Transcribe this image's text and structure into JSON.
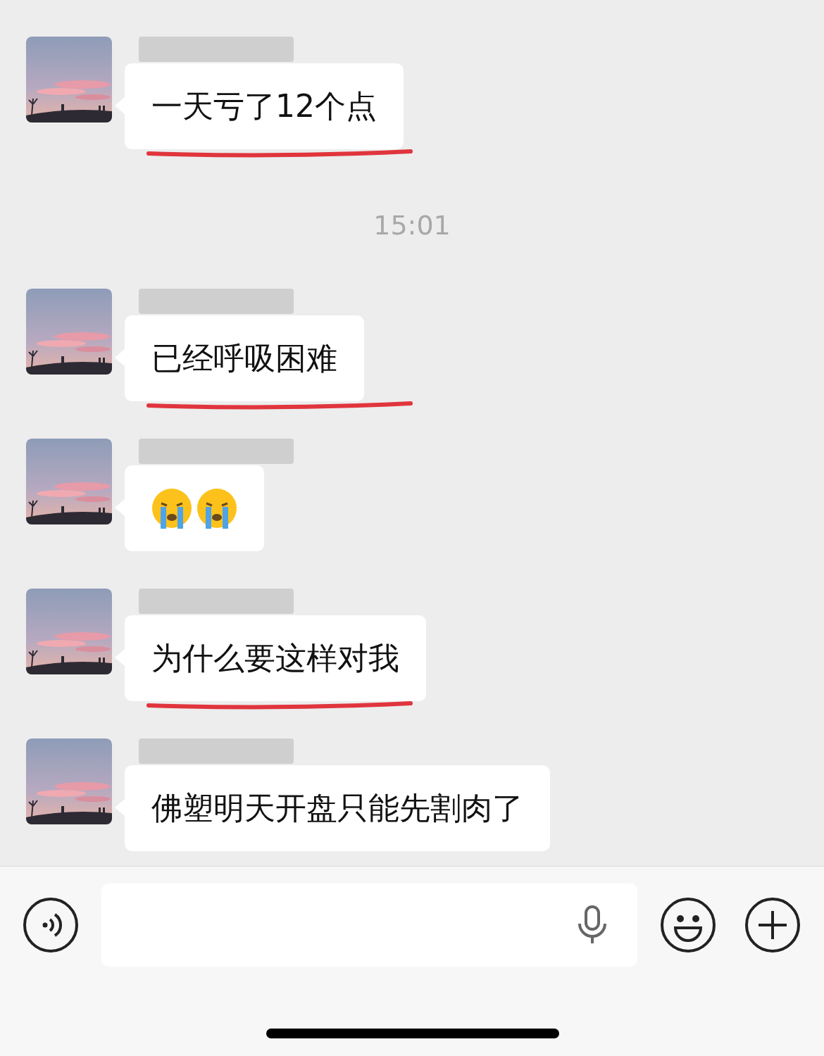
{
  "chat": [
    {
      "kind": "message",
      "text": "一天亏了12个点",
      "underlined": true
    },
    {
      "kind": "time",
      "text": "15:01"
    },
    {
      "kind": "message",
      "text": "已经呼吸困难",
      "underlined": true
    },
    {
      "kind": "emoji"
    },
    {
      "kind": "message",
      "text": "为什么要这样对我",
      "underlined": true
    },
    {
      "kind": "message",
      "text": "佛塑明天开盘只能先割肉了",
      "underlined": false
    }
  ]
}
